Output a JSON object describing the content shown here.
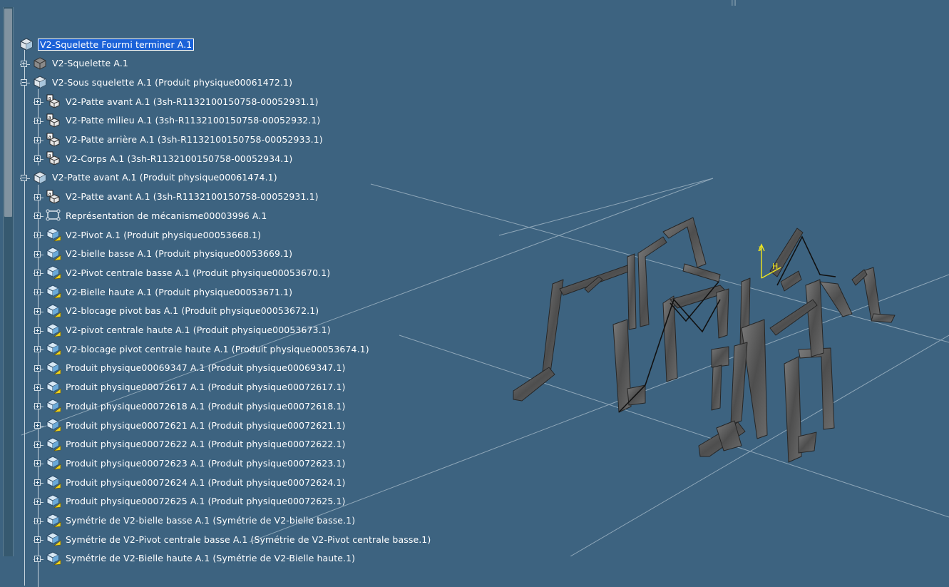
{
  "colors": {
    "background": "#3d6380",
    "tree_text": "#ffffff",
    "selection": "#1b62d8",
    "grid": "#a9bdcb",
    "part_metal": "#5a5a5a",
    "axis_yellow": "#f0e61e"
  },
  "tree": {
    "root": {
      "label": "V2-Squelette Fourmi terminer A.1",
      "icon": "product-root-icon",
      "selected": true
    },
    "nodes": [
      {
        "label": "V2-Squelette A.1",
        "icon": "part-body-icon",
        "depth": 1,
        "expander": "plus"
      },
      {
        "label": "V2-Sous squelette A.1 (Produit physique00061472.1)",
        "icon": "product-icon",
        "depth": 1,
        "expander": "minus"
      },
      {
        "label": "V2-Patte avant A.1 (3sh-R1132100150758-00052931.1)",
        "icon": "shape-instance-icon",
        "depth": 2,
        "expander": "plus"
      },
      {
        "label": "V2-Patte milieu A.1 (3sh-R1132100150758-00052932.1)",
        "icon": "shape-instance-icon",
        "depth": 2,
        "expander": "plus"
      },
      {
        "label": "V2-Patte arrière A.1 (3sh-R1132100150758-00052933.1)",
        "icon": "shape-instance-icon",
        "depth": 2,
        "expander": "plus"
      },
      {
        "label": "V2-Corps A.1 (3sh-R1132100150758-00052934.1)",
        "icon": "shape-instance-icon",
        "depth": 2,
        "expander": "plus"
      },
      {
        "label": "V2-Patte avant A.1 (Produit physique00061474.1)",
        "icon": "product-icon",
        "depth": 1,
        "expander": "minus"
      },
      {
        "label": "V2-Patte avant A.1 (3sh-R1132100150758-00052931.1)",
        "icon": "shape-instance-icon",
        "depth": 2,
        "expander": "plus"
      },
      {
        "label": "Représentation de mécanisme00003996 A.1",
        "icon": "mechanism-icon",
        "depth": 2,
        "expander": "plus"
      },
      {
        "label": "V2-Pivot A.1 (Produit physique00053668.1)",
        "icon": "physical-product-icon",
        "depth": 2,
        "expander": "plus"
      },
      {
        "label": "V2-bielle basse A.1 (Produit physique00053669.1)",
        "icon": "physical-product-icon",
        "depth": 2,
        "expander": "plus"
      },
      {
        "label": "V2-Pivot centrale basse A.1 (Produit physique00053670.1)",
        "icon": "physical-product-icon",
        "depth": 2,
        "expander": "plus"
      },
      {
        "label": "V2-Bielle haute A.1 (Produit physique00053671.1)",
        "icon": "physical-product-icon",
        "depth": 2,
        "expander": "plus"
      },
      {
        "label": "V2-blocage pivot bas A.1 (Produit physique00053672.1)",
        "icon": "physical-product-icon",
        "depth": 2,
        "expander": "plus"
      },
      {
        "label": "V2-pivot centrale haute A.1 (Produit physique00053673.1)",
        "icon": "physical-product-icon",
        "depth": 2,
        "expander": "plus"
      },
      {
        "label": "V2-blocage pivot centrale haute A.1 (Produit physique00053674.1)",
        "icon": "physical-product-icon",
        "depth": 2,
        "expander": "plus"
      },
      {
        "label": "Produit physique00069347 A.1 (Produit physique00069347.1)",
        "icon": "physical-product-icon",
        "depth": 2,
        "expander": "plus"
      },
      {
        "label": "Produit physique00072617 A.1 (Produit physique00072617.1)",
        "icon": "physical-product-icon",
        "depth": 2,
        "expander": "plus"
      },
      {
        "label": "Produit physique00072618 A.1 (Produit physique00072618.1)",
        "icon": "physical-product-icon",
        "depth": 2,
        "expander": "plus"
      },
      {
        "label": "Produit physique00072621 A.1 (Produit physique00072621.1)",
        "icon": "physical-product-icon",
        "depth": 2,
        "expander": "plus"
      },
      {
        "label": "Produit physique00072622 A.1 (Produit physique00072622.1)",
        "icon": "physical-product-icon",
        "depth": 2,
        "expander": "plus"
      },
      {
        "label": "Produit physique00072623 A.1 (Produit physique00072623.1)",
        "icon": "physical-product-icon",
        "depth": 2,
        "expander": "plus"
      },
      {
        "label": "Produit physique00072624 A.1 (Produit physique00072624.1)",
        "icon": "physical-product-icon",
        "depth": 2,
        "expander": "plus"
      },
      {
        "label": "Produit physique00072625 A.1 (Produit physique00072625.1)",
        "icon": "physical-product-icon",
        "depth": 2,
        "expander": "plus"
      },
      {
        "label": "Symétrie de V2-bielle basse A.1 (Symétrie de V2-bielle basse.1)",
        "icon": "physical-product-icon",
        "depth": 2,
        "expander": "plus"
      },
      {
        "label": "Symétrie de V2-Pivot centrale basse A.1 (Symétrie de V2-Pivot centrale basse.1)",
        "icon": "physical-product-icon",
        "depth": 2,
        "expander": "plus"
      },
      {
        "label": "Symétrie de V2-Bielle haute A.1 (Symétrie de V2-Bielle haute.1)",
        "icon": "physical-product-icon",
        "depth": 2,
        "expander": "plus"
      }
    ]
  },
  "viewport": {
    "model": "ant-skeleton-3d-model",
    "compass_labels": {
      "y": "y",
      "h": "H"
    }
  }
}
